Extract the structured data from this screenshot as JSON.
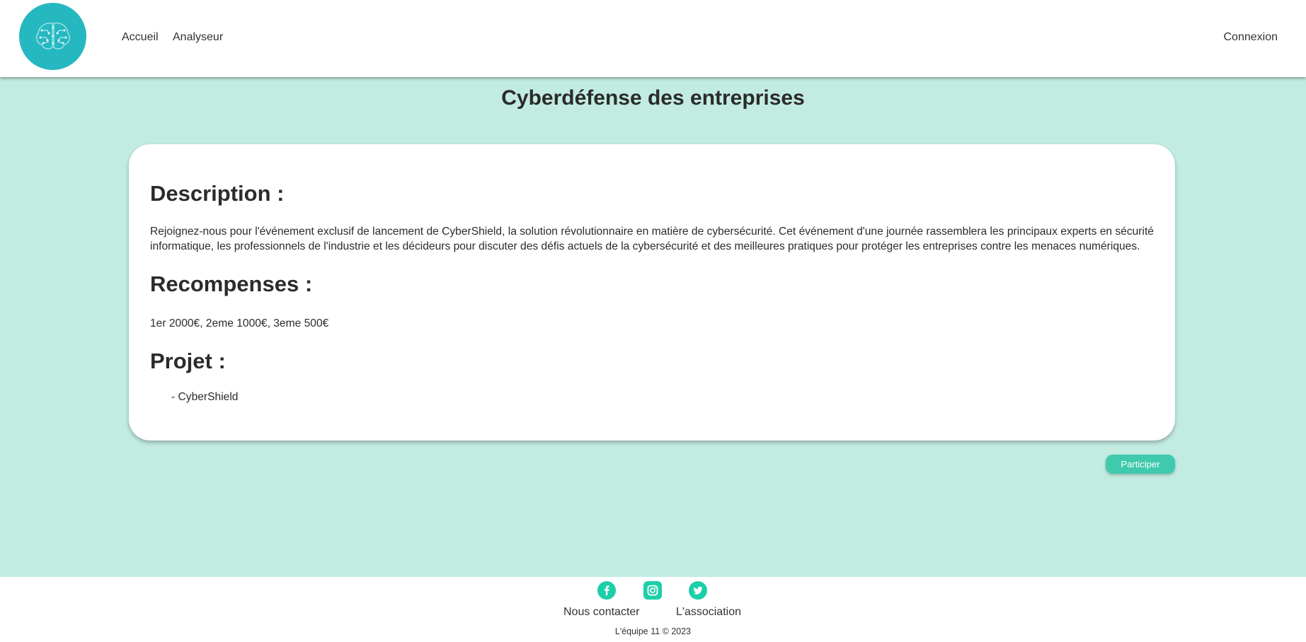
{
  "header": {
    "logo_icon": "brain-circuit-icon",
    "nav": {
      "accueil": "Accueil",
      "analyseur": "Analyseur",
      "connexion": "Connexion"
    }
  },
  "main": {
    "title": "Cyberdéfense des entreprises",
    "description": {
      "heading": "Description :",
      "text": "Rejoignez-nous pour l'événement exclusif de lancement de CyberShield, la solution révolutionnaire en matière de cybersécurité. Cet événement d'une journée rassemblera les principaux experts en sécurité informatique, les professionnels de l'industrie et les décideurs pour discuter des défis actuels de la cybersécurité et des meilleures pratiques pour protéger les entreprises contre les menaces numériques."
    },
    "rewards": {
      "heading": "Recompenses :",
      "text": "1er 2000€, 2eme 1000€, 3eme 500€"
    },
    "project": {
      "heading": "Projet :",
      "items": [
        "- CyberShield"
      ]
    },
    "participate_label": "Participer"
  },
  "footer": {
    "social_icons": [
      "facebook-icon",
      "instagram-icon",
      "twitter-icon"
    ],
    "contact_label": "Nous contacter",
    "association_label": "L'association",
    "copyright": "L'équipe 11 © 2023"
  },
  "colors": {
    "page_background": "#c2ece1",
    "logo": "#26b8c0",
    "accent_button": "#3fc9ad",
    "social_icons": "#1ccfa8"
  }
}
